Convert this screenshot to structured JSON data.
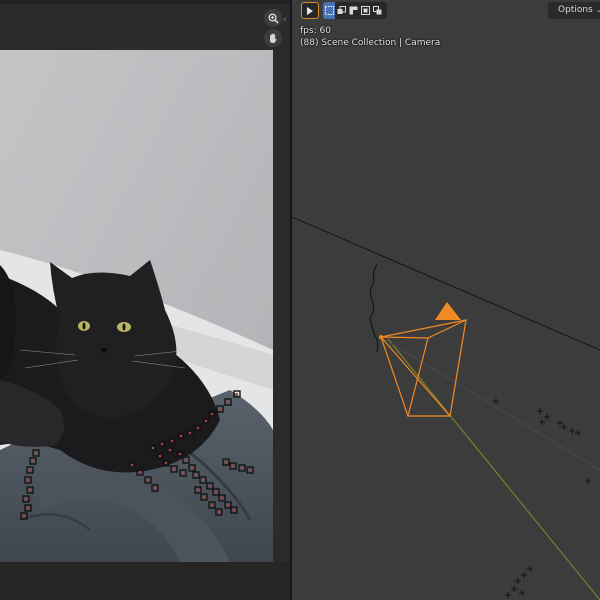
{
  "clip_editor": {
    "zoom_icon": "zoom-magnifier-icon",
    "pan_icon": "hand-pan-icon",
    "track_marker_count": 46
  },
  "viewport": {
    "header": {
      "play_icon": "play-icon",
      "mode_icons": [
        "select-box-icon",
        "select-extend-icon",
        "select-subtract-icon",
        "select-invert-icon",
        "select-intersect-icon"
      ],
      "options_label": "Options"
    },
    "overlay": {
      "fps": "fps: 60",
      "object_info": "(88) Scene Collection | Camera"
    },
    "colors": {
      "camera_selected": "#f08a24",
      "y_axis": "#8a9a2a",
      "background": "#3c3c3c"
    }
  }
}
